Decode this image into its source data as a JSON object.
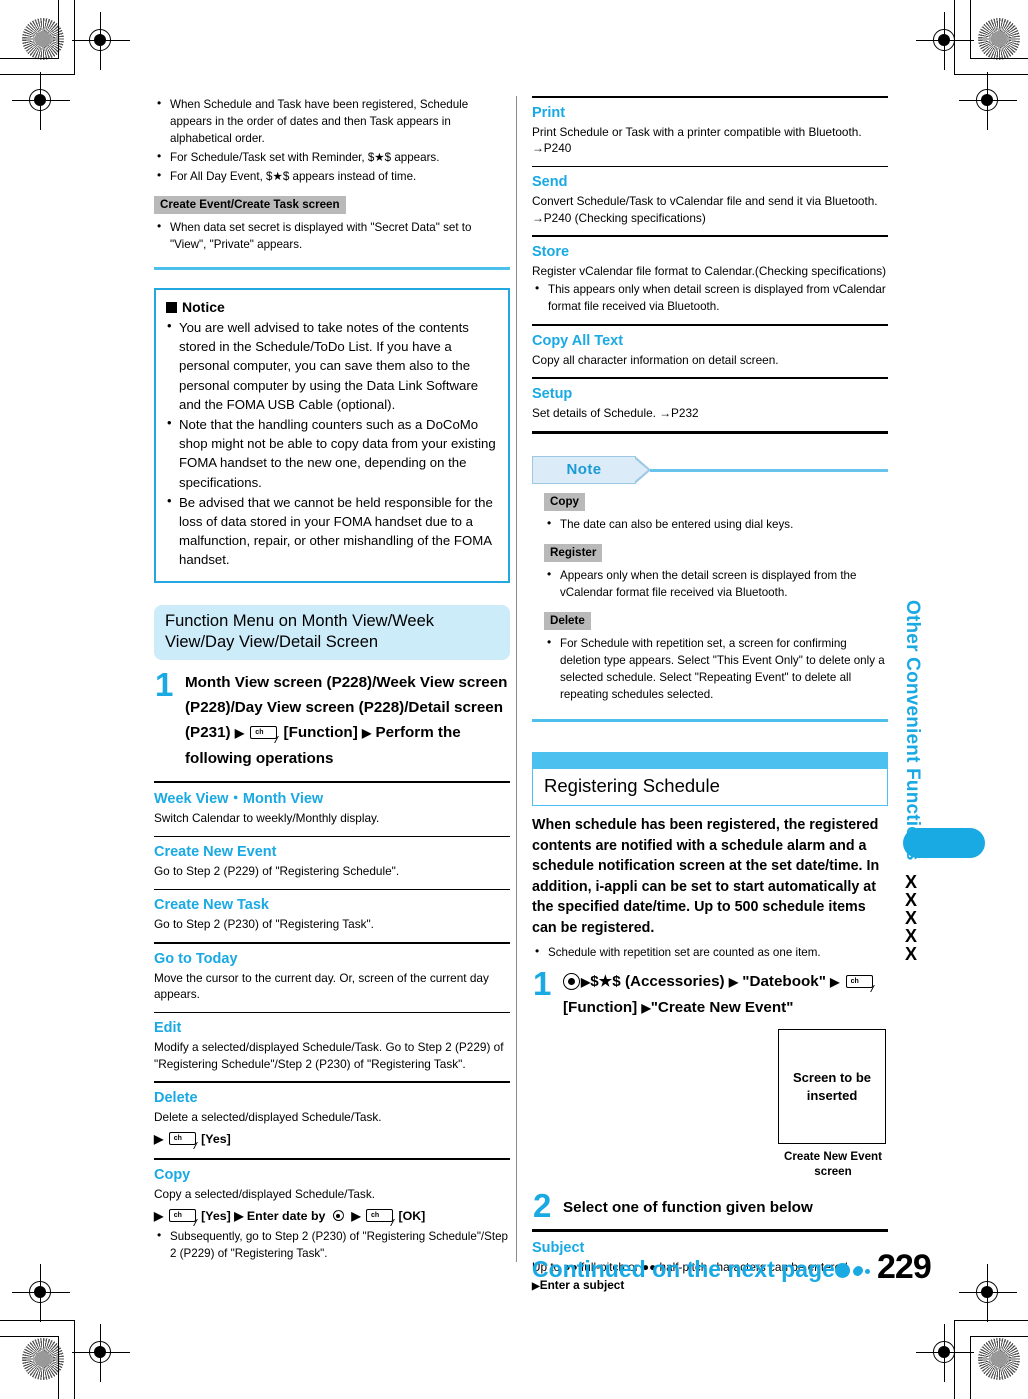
{
  "page": {
    "number": "229",
    "chapter_title": "Other Convenient Functions",
    "side_code": "XXXXX",
    "continued_label": "Continued on the next page"
  },
  "left_column": {
    "top_bullets": [
      "When Schedule and Task have been registered, Schedule appears in the order of dates and then Task appears in alphabetical order.",
      "For Schedule/Task set with Reminder, $★$ appears.",
      "For All Day Event, $★$ appears instead of time."
    ],
    "screen_tag": "Create Event/Create Task screen",
    "screen_bullets": [
      "When data set secret is displayed with \"Secret Data\" set to \"View\", \"Private\" appears."
    ],
    "notice": {
      "title": "Notice",
      "items": [
        "You are well advised to take notes of the contents stored in the Schedule/ToDo List. If you have a personal computer, you can save them also to the personal computer by using the Data Link Software and the FOMA USB Cable (optional).",
        "Note that the handling counters such as a DoCoMo shop might not be able to copy data from your existing FOMA handset to the new one, depending on the specifications.",
        "Be advised that we cannot be held responsible for the loss of data stored in your FOMA handset due to a malfunction, repair, or other mishandling of the FOMA handset."
      ]
    },
    "function_menu": {
      "title": "Function Menu on Month View/Week View/Day View/Detail Screen",
      "step_number": "1",
      "step_part1": "Month View screen (P228)/Week View screen (P228)/Day View screen (P228)/Detail screen (P231)",
      "step_key_label": "ch",
      "step_part2": "[Function]",
      "step_part3": "Perform the following operations"
    },
    "entries": [
      {
        "head": "Week View・Month View",
        "body": "Switch Calendar to weekly/Monthly display."
      },
      {
        "head": "Create New Event",
        "body": "Go to Step 2 (P229) of \"Registering Schedule\"."
      },
      {
        "head": "Create New Task",
        "body": "Go to Step 2 (P230) of \"Registering Task\"."
      },
      {
        "head": "Go to Today",
        "body": "Move the cursor to the current day. Or, screen of the current day appears."
      },
      {
        "head": "Edit",
        "body": "Modify a selected/displayed Schedule/Task. Go to Step 2 (P229) of \"Registering Schedule\"/Step 2 (P230) of \"Registering Task\"."
      },
      {
        "head": "Delete",
        "body": "Delete a selected/displayed Schedule/Task.",
        "op_yes": "[Yes]",
        "key": "ch"
      },
      {
        "head": "Copy",
        "body": "Copy a selected/displayed Schedule/Task.",
        "op_yes": "[Yes]",
        "op_enter": "Enter date by",
        "op_ok": "[OK]",
        "key": "ch",
        "sub_bullets": [
          "Subsequently, go to Step 2 (P230) of \"Registering Schedule\"/Step 2 (P229) of \"Registering Task\"."
        ]
      }
    ]
  },
  "right_column": {
    "entries": [
      {
        "head": "Print",
        "body": "Print Schedule or Task with a printer compatible with Bluetooth. →P240"
      },
      {
        "head": "Send",
        "body": "Convert Schedule/Task to vCalendar file and send it via Bluetooth. →P240 (Checking specifications)"
      },
      {
        "head": "Store",
        "body": "Register vCalendar file format to Calendar.(Checking specifications)",
        "sub_bullets": [
          "This appears only when detail screen is displayed from vCalendar format file received via Bluetooth."
        ]
      },
      {
        "head": "Copy All Text",
        "body": "Copy all character information on detail screen."
      },
      {
        "head": "Setup",
        "body": "Set details of Schedule. →P232"
      }
    ],
    "note": {
      "label": "Note",
      "groups": [
        {
          "tag": "Copy",
          "bullets": [
            "The date can also be entered using dial keys."
          ]
        },
        {
          "tag": "Register",
          "bullets": [
            "Appears only when the detail screen is displayed from the vCalendar format file received via Bluetooth."
          ]
        },
        {
          "tag": "Delete",
          "bullets": [
            "For Schedule with repetition set, a screen for confirming deletion type appears. Select \"This Event Only\" to delete only a selected schedule. Select \"Repeating Event\" to delete all repeating schedules selected."
          ]
        }
      ]
    },
    "registering_schedule": {
      "title": "Registering Schedule",
      "intro": "When schedule has been registered, the registered contents are notified with a schedule alarm and a schedule notification screen at the set date/time. In addition, i-appli can be set to start automatically at the specified date/time. Up to 500 schedule items can be registered.",
      "bullets": [
        "Schedule with repetition set are counted as one item."
      ],
      "step1": {
        "number": "1",
        "part_accessories": "$★$ (Accessories)",
        "part_datebook": "\"Datebook\"",
        "key_label": "ch",
        "part_function": "[Function]",
        "part_create": "\"Create New Event\""
      },
      "screen_placeholder": {
        "text": "Screen to be inserted",
        "caption": "Create New Event screen"
      },
      "step2": {
        "number": "2",
        "text": "Select one of function given below"
      },
      "subject_entry": {
        "head": "Subject",
        "body": "Up to ●● full-pitch or ●● half-pitch characters can be entered.",
        "op": "Enter a subject"
      }
    }
  }
}
